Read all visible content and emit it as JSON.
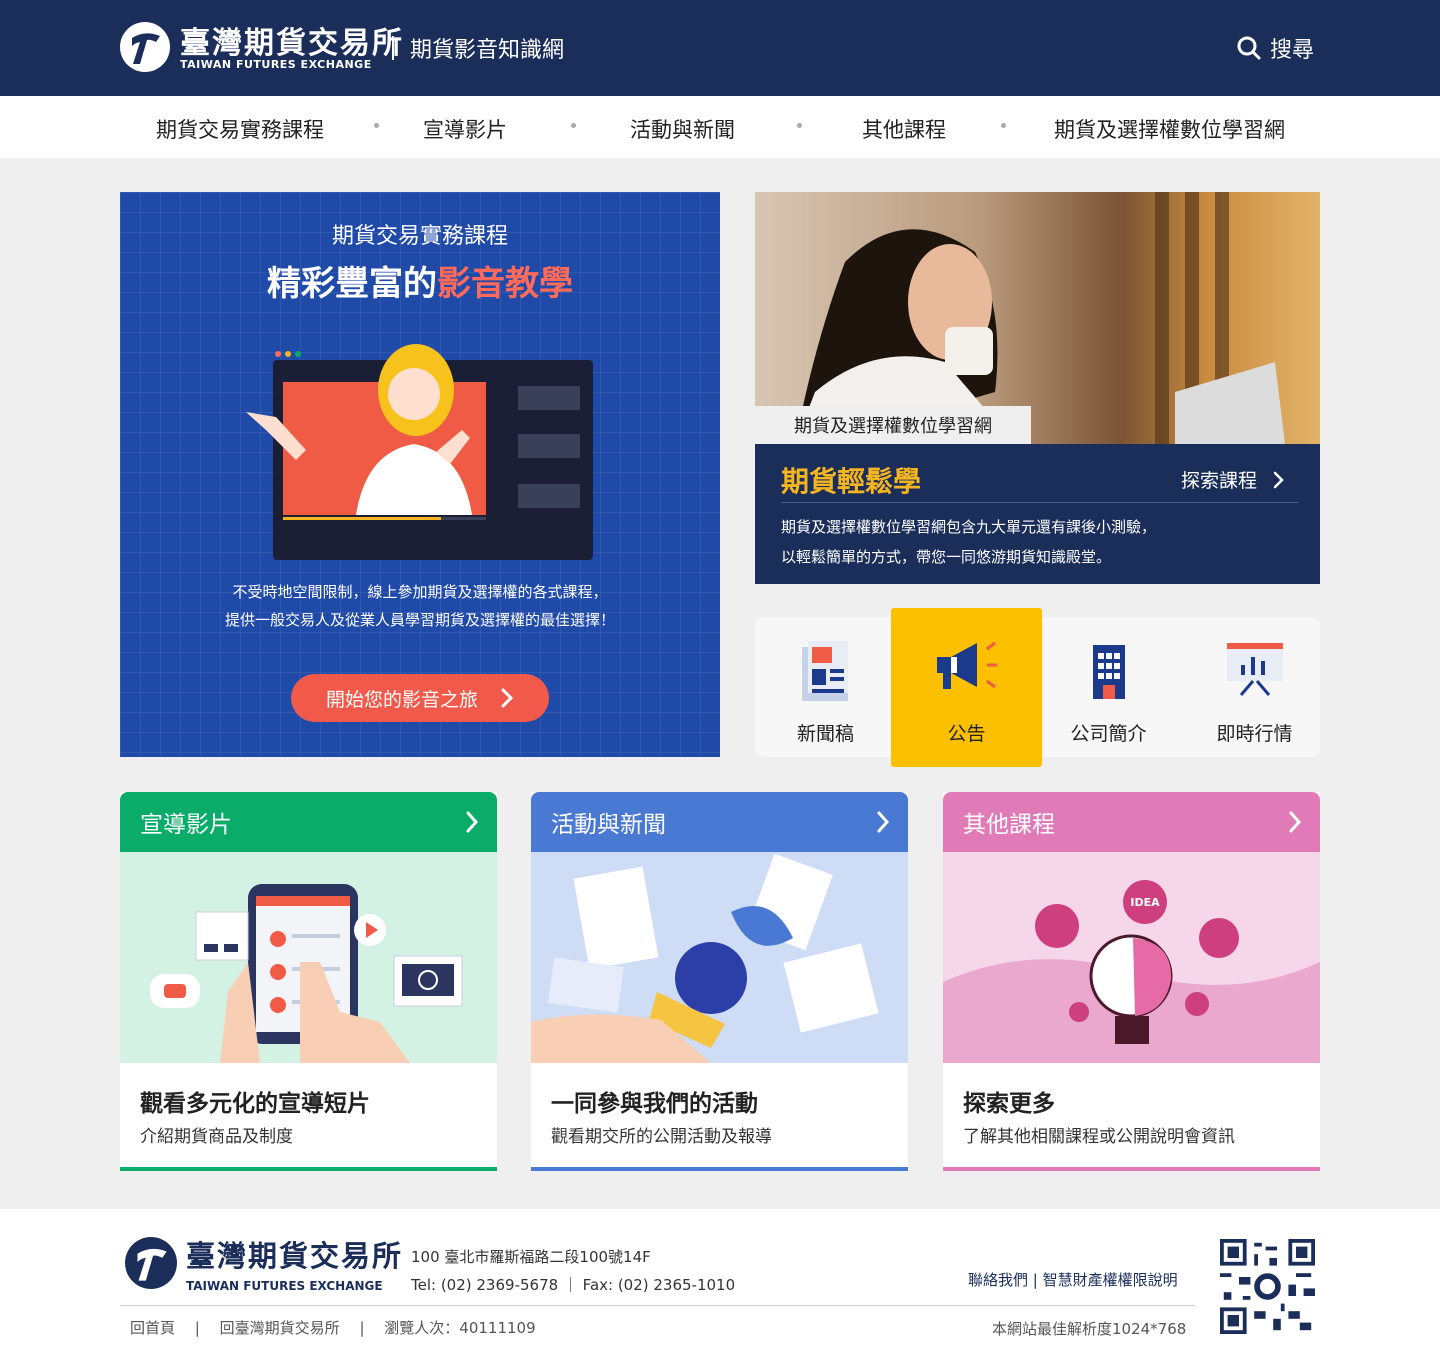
{
  "header": {
    "logo_cn": "臺灣期貨交易所",
    "logo_en": "TAIWAN FUTURES EXCHANGE",
    "site_title": "期貨影音知識網",
    "search_label": "搜尋"
  },
  "nav": {
    "items": [
      "期貨交易實務課程",
      "宣導影片",
      "活動與新聞",
      "其他課程",
      "期貨及選擇權數位學習網"
    ]
  },
  "hero": {
    "subtitle": "期貨交易實務課程",
    "title_main": "精彩豐富的",
    "title_highlight": "影音教學",
    "desc_line1": "不受時地空間限制，線上參加期貨及選擇權的各式課程，",
    "desc_line2": "提供一般交易人及從業人員學習期貨及選擇權的最佳選擇！",
    "button_label": "開始您的影音之旅"
  },
  "promo": {
    "tag": "期貨及選擇權數位學習網",
    "title": "期貨輕鬆學",
    "link_label": "探索課程",
    "desc_line1": "期貨及選擇權數位學習網包含九大單元還有課後小測驗，",
    "desc_line2": "以輕鬆簡單的方式，帶您一同悠游期貨知識殿堂。"
  },
  "quick_links": [
    {
      "label": "新聞稿",
      "icon": "newspaper-icon"
    },
    {
      "label": "公告",
      "icon": "megaphone-icon"
    },
    {
      "label": "公司簡介",
      "icon": "building-icon"
    },
    {
      "label": "即時行情",
      "icon": "chart-board-icon"
    }
  ],
  "cards": [
    {
      "header": "宣導影片",
      "title": "觀看多元化的宣導短片",
      "desc": "介紹期貨商品及制度",
      "color": "#0bab6a"
    },
    {
      "header": "活動與新聞",
      "title": "一同參與我們的活動",
      "desc": "觀看期交所的公開活動及報導",
      "color": "#4a79d4"
    },
    {
      "header": "其他課程",
      "title": "探索更多",
      "desc": "了解其他相關課程或公開說明會資訊",
      "color": "#e07bb8"
    }
  ],
  "card_art": {
    "idea_label": "IDEA"
  },
  "footer": {
    "logo_cn": "臺灣期貨交易所",
    "logo_en": "TAIWAN FUTURES EXCHANGE",
    "address": "100 臺北市羅斯福路二段100號14F",
    "phone": "Tel: (02) 2369-5678 ｜ Fax: (02) 2365-1010",
    "link_contact": "聯絡我們",
    "link_ip": "智慧財產權權限說明",
    "link_home": "回首頁",
    "link_taifex": "回臺灣期貨交易所",
    "visitors": "瀏覽人次：40111109",
    "resolution": "本網站最佳解析度1024*768"
  },
  "colors": {
    "navy": "#1b2e5a",
    "hero_blue": "#1f4aa8",
    "accent_orange": "#f15a4a",
    "gold": "#f5b520",
    "active_yellow": "#fdc000"
  }
}
